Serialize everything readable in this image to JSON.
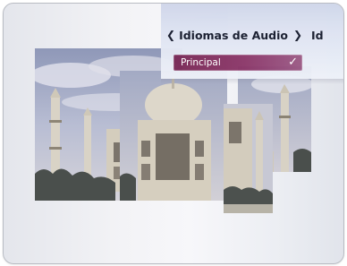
{
  "menu": {
    "left_arrow": "❮",
    "title": "Idiomas de Audio",
    "right_arrow": "❯",
    "next_partial": "Id",
    "selected_item": "Principal",
    "check": "✓"
  },
  "colors": {
    "sky": "#9fa8c4",
    "marble": "#cfc9bc",
    "selection": "#7a2a57"
  }
}
